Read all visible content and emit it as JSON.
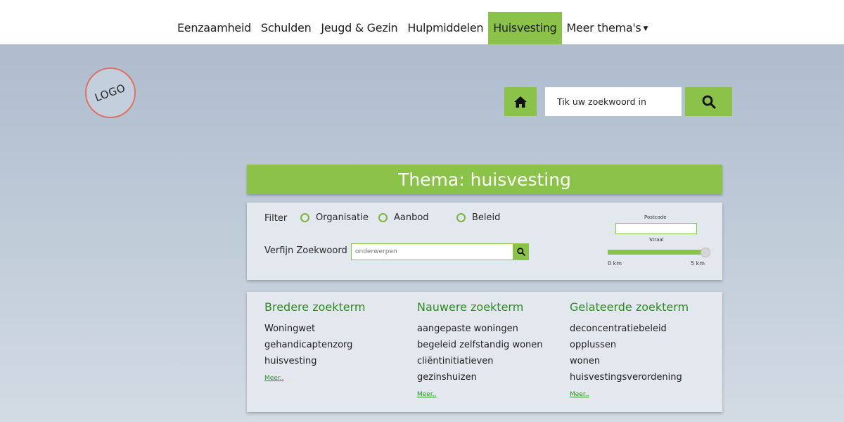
{
  "nav": {
    "items": [
      {
        "label": "Eenzaamheid",
        "active": false
      },
      {
        "label": "Schulden",
        "active": false
      },
      {
        "label": "Jeugd & Gezin",
        "active": false
      },
      {
        "label": "Hulpmiddelen",
        "active": false
      },
      {
        "label": "Huisvesting",
        "active": true
      },
      {
        "label": "Meer thema's",
        "active": false
      }
    ]
  },
  "logo": {
    "text": "LOGO"
  },
  "header": {
    "home_icon": "home-icon",
    "search_placeholder": "Tik uw zoekwoord in",
    "search_icon": "search-icon"
  },
  "theme": {
    "title": "Thema: huisvesting"
  },
  "filter": {
    "label": "Filter",
    "options": [
      "Organisatie",
      "Aanbod",
      "Beleid"
    ],
    "refine_label": "Verfijn Zoekwoord",
    "refine_placeholder": "onderwerpen",
    "postcode_label": "Postcode",
    "radius_label": "Straal",
    "radius_min": "0 km",
    "radius_max": "5 km",
    "radius_value_fraction": 1.0
  },
  "terms": {
    "columns": [
      {
        "title": "Bredere zoekterm",
        "items": [
          "Woningwet",
          "gehandicaptenzorg",
          "huisvesting"
        ],
        "more": "Meer.."
      },
      {
        "title": "Nauwere zoekterm",
        "items": [
          "aangepaste woningen",
          "begeleid zelfstandig wonen",
          "cliëntinitiatieven",
          "gezinshuizen"
        ],
        "more": "Meer.."
      },
      {
        "title": "Gelateerde zoekterm",
        "items": [
          "deconcentratiebeleid",
          "opplussen",
          "wonen",
          "huisvestingsverordening"
        ],
        "more": "Meer.."
      }
    ]
  },
  "colors": {
    "accent": "#8bc34a",
    "term_title": "#2e8b22",
    "logo_border": "#e07064"
  }
}
